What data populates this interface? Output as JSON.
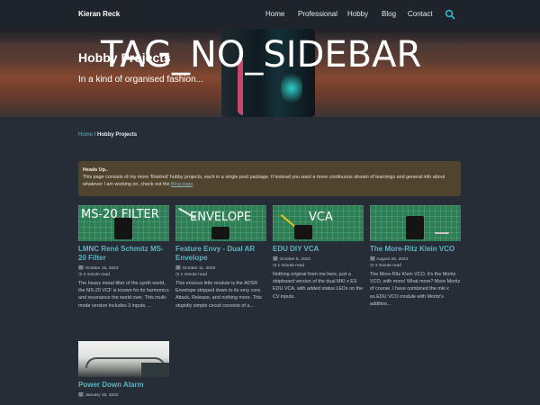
{
  "header": {
    "brand": "Kieran Reck",
    "nav": [
      "Home",
      "Professional",
      "Hobby",
      "Blog",
      "Contact"
    ],
    "search_icon": "search-icon"
  },
  "hero": {
    "overlay_tag": "TAG_NO_SIDEBAR",
    "title": "Hobby Projects",
    "subtitle": "In a kind of organised fashion..."
  },
  "breadcrumb": {
    "home": "Home",
    "sep": " / ",
    "current": "Hobby Projects"
  },
  "notice": {
    "heading": "Heads Up..",
    "text": "This page consists of my more ‘finished’ hobby projects, each in a single post package. If instead you want a more continuous stream of learnings and general info about whatever I am working on, check out the ",
    "link": "Blog page",
    "end": "."
  },
  "cards": [
    {
      "thumb_label": "MS-20 FILTER",
      "title": "LMNC René Schmitz MS-20 Filter",
      "date": "October 15, 2023",
      "read": "2 minute read",
      "excerpt": "The heavy metal filter of the synth world, the MS-20 VCF is known for its harmonics and resonance the world over. This multi-mode version includes 3 inputs, ..."
    },
    {
      "thumb_label": "ENVELOPE",
      "title": "Feature Envy - Dual AR Envelope",
      "date": "October 11, 2023",
      "read": "1 minute read",
      "excerpt": "This envious little module is the ADSR Envelope stripped down to its very core. Attack, Release, and nothing more. This stupidly simple circuit consists of a..."
    },
    {
      "thumb_label": "VCA",
      "title": "EDU DIY VCA",
      "date": "October 6, 2023",
      "read": "1 minute read",
      "excerpt": "Nothing original from me here, just a stripboard version of the dual MKI x ES EDU VCA, with added status LEDs on the CV inputs."
    },
    {
      "thumb_label": "",
      "title": "The More-Ritz Klein VCO",
      "date": "August 26, 2023",
      "read": "4 minute read",
      "excerpt": "The More-Ritz Klein VCO, it's the Moritz VCO, with more! What more? More Moritz of course. I have combined the mki x es.EDU VCO module with Moritz's addition..."
    },
    {
      "thumb_label": "",
      "title": "Power Down Alarm",
      "date": "January 16, 2022",
      "read": "",
      "excerpt": ""
    }
  ]
}
